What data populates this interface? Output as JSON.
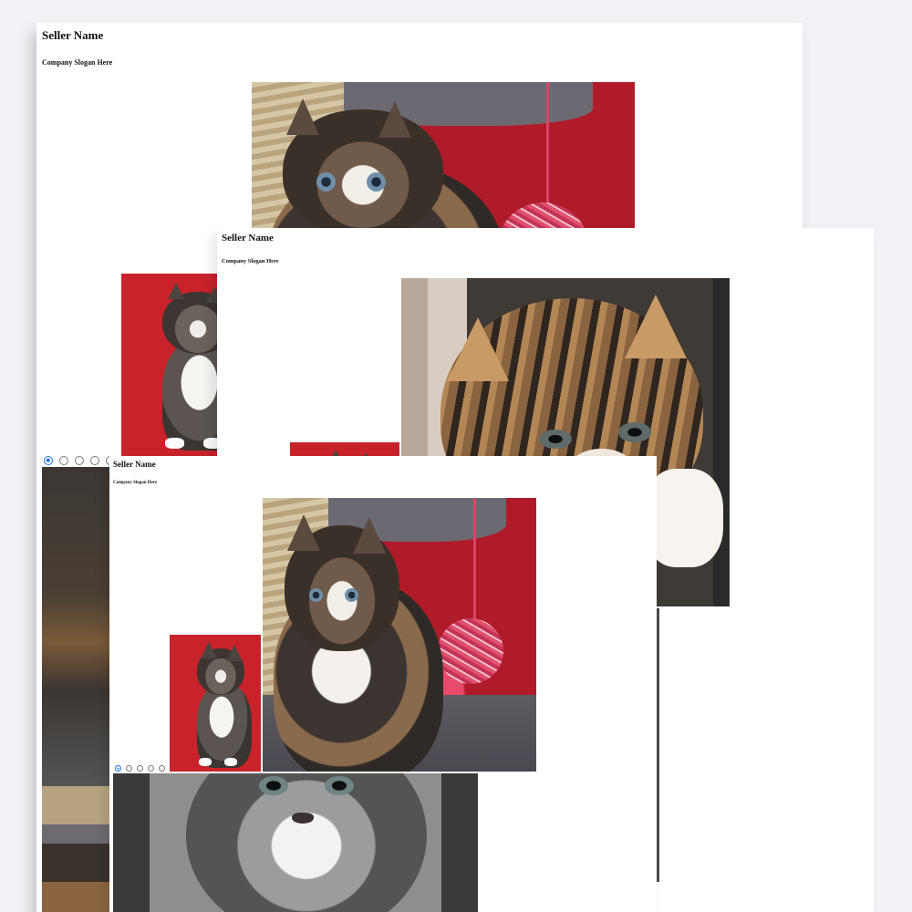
{
  "windows": [
    {
      "seller_name": "Seller Name",
      "slogan": "Company Slogan Here"
    },
    {
      "seller_name": "Seller Name",
      "slogan": "Company Slogan Here"
    },
    {
      "seller_name": "Seller Name",
      "slogan": "Company Slogan Here"
    }
  ],
  "images": {
    "main_1": "kitten-with-yarn-ball-photo",
    "thumb_1": "kitten-on-red-photo",
    "main_2": "tabby-kitten-closeup-photo",
    "thumb_2": "kitten-on-red-photo",
    "main_3": "kitten-with-yarn-ball-photo",
    "thumb_3": "kitten-on-red-photo",
    "below_3": "grey-kitten-closeup-photo"
  },
  "carousel": {
    "window_1": {
      "count": 5,
      "selected_index": 0
    },
    "window_3": {
      "count": 5,
      "selected_index": 0
    }
  },
  "colors": {
    "radio_accent": "#1a73e8",
    "page_bg": "#f0f2f5"
  }
}
